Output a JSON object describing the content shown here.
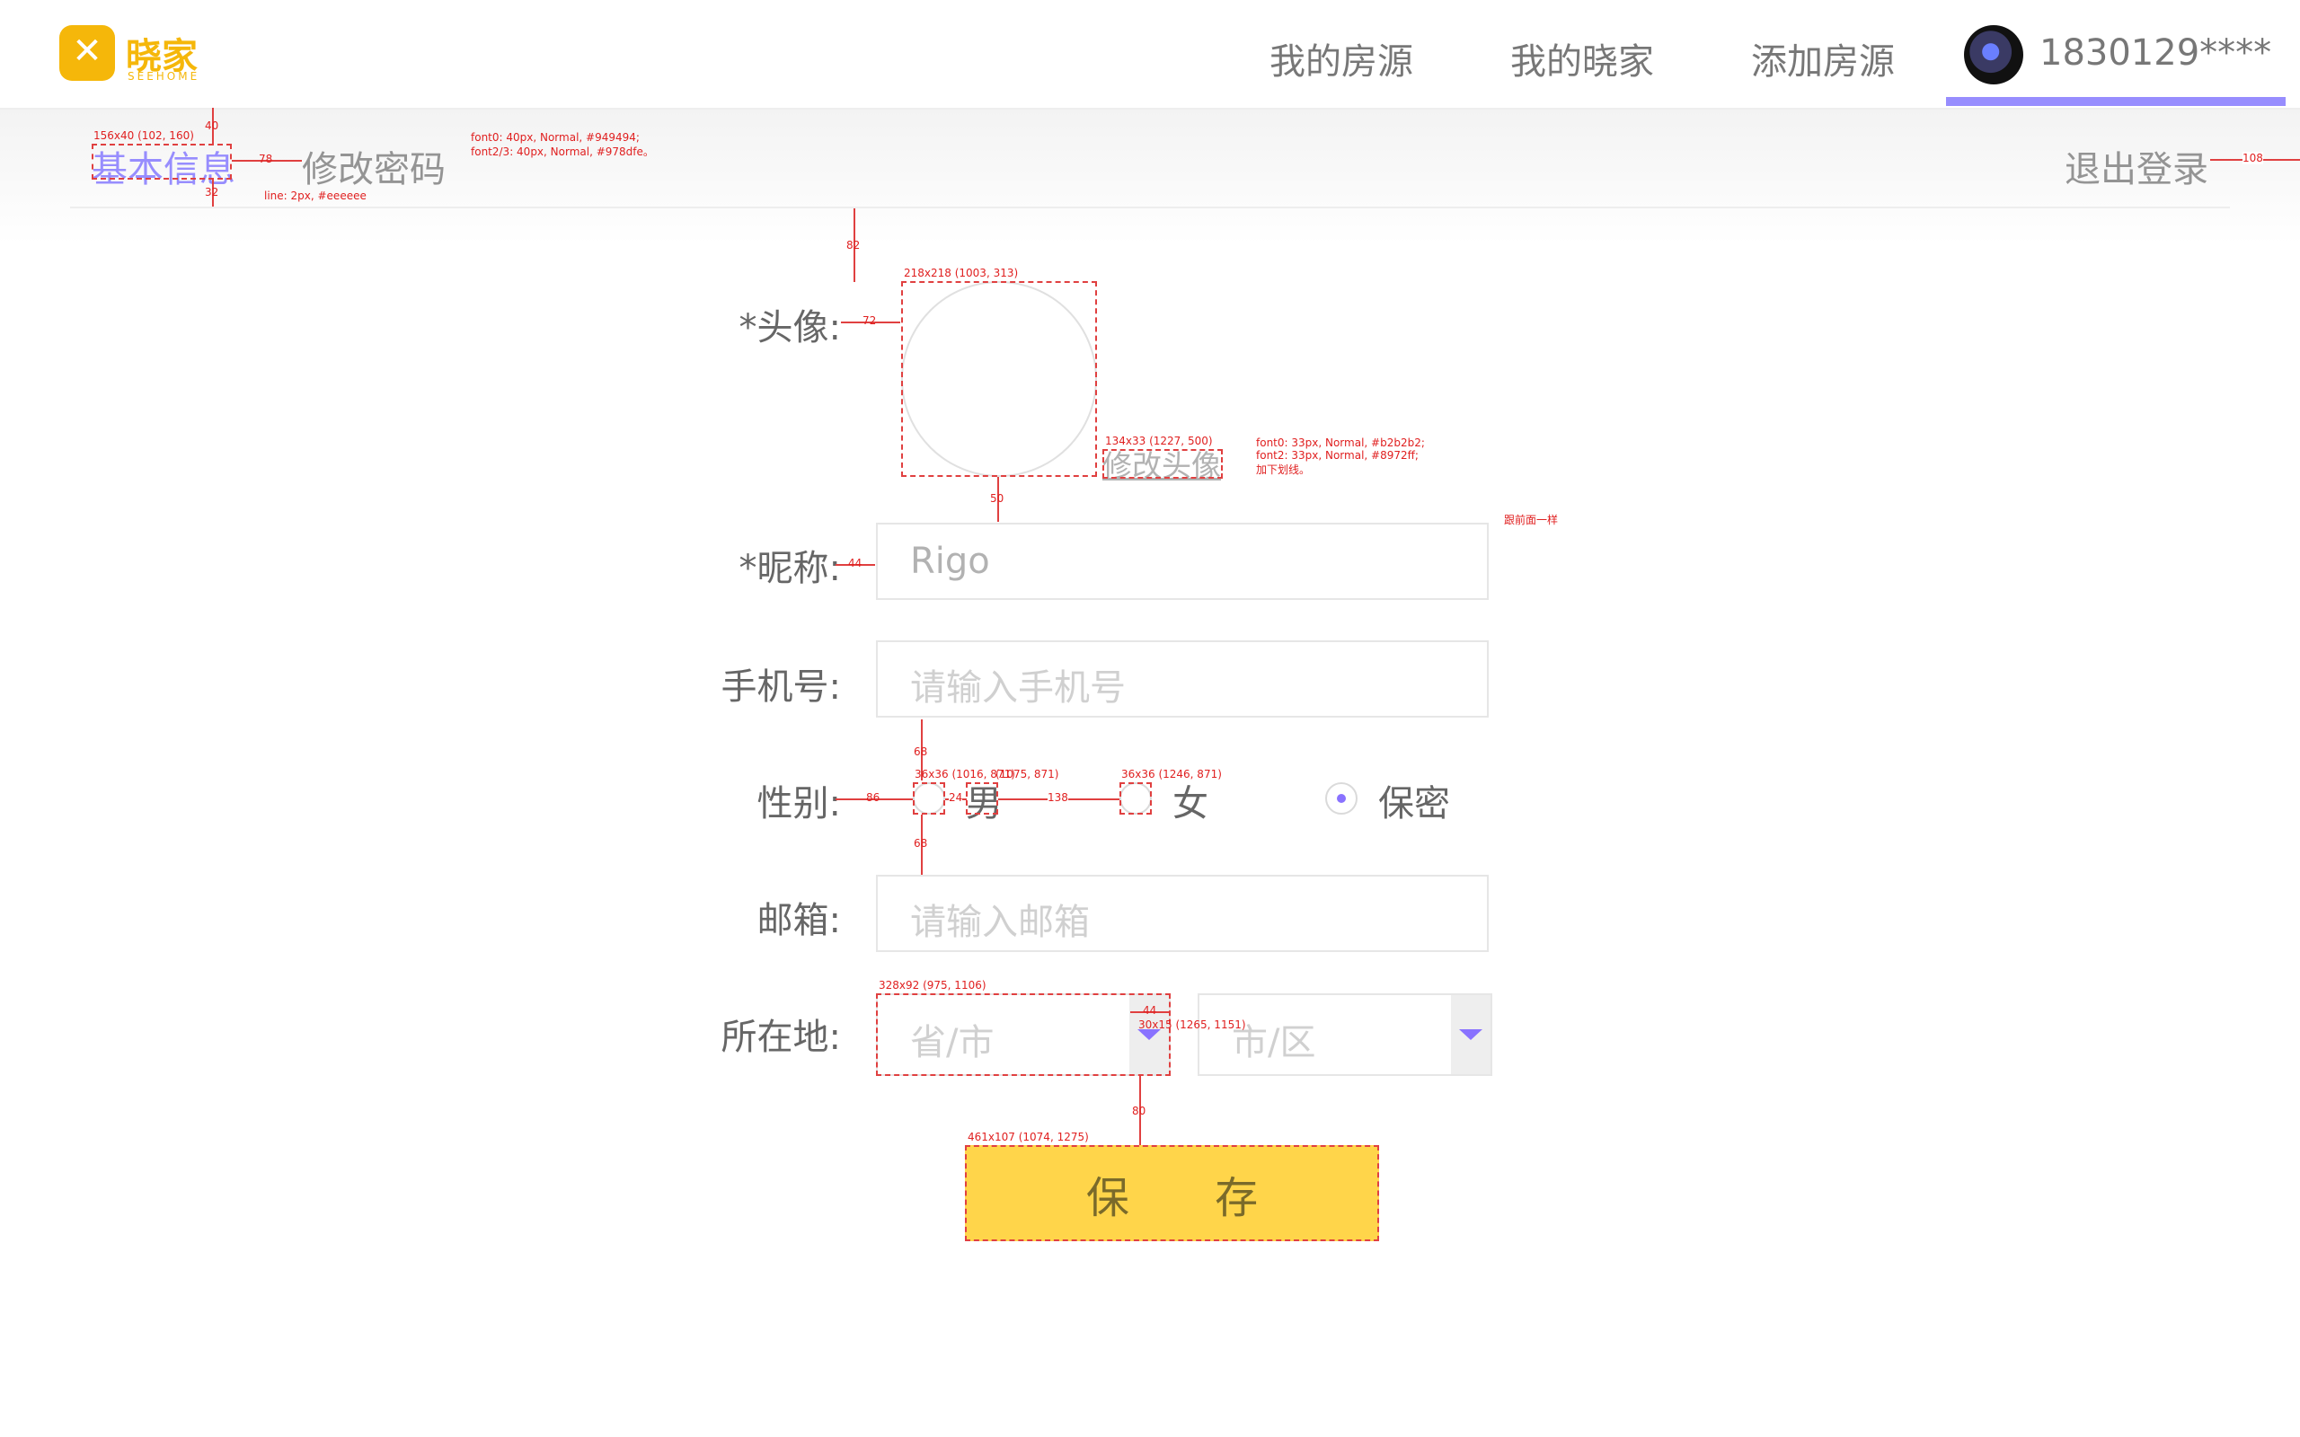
{
  "brand": {
    "name_cn": "晓家",
    "name_en": "SEEHOME"
  },
  "nav": {
    "links": [
      "我的房源",
      "我的晓家",
      "添加房源"
    ],
    "user": "1830129****"
  },
  "subnav": {
    "tab_basic": "基本信息",
    "tab_password": "修改密码",
    "logout": "退出登录"
  },
  "form": {
    "avatar_label": "*头像:",
    "change_avatar": "修改头像",
    "nickname_label": "*昵称:",
    "nickname_value": "Rigo",
    "phone_label": "手机号:",
    "phone_placeholder": "请输入手机号",
    "gender_label": "性别:",
    "gender_options": [
      "男",
      "女",
      "保密"
    ],
    "gender_selected": "保密",
    "email_label": "邮箱:",
    "email_placeholder": "请输入邮箱",
    "location_label": "所在地:",
    "province_placeholder": "省/市",
    "city_placeholder": "市/区",
    "save": "保 存"
  },
  "colors": {
    "accent": "#978dfe",
    "brand": "#f5b70a",
    "button": "#ffd54a",
    "text_gray": "#949494",
    "line": "#eeeeee"
  },
  "annotations": {
    "a1": "156x40 (102, 160)",
    "a2": "40",
    "a3": "78",
    "a4": "32",
    "a5": "font0: 40px, Normal, #949494;",
    "a6": "font2/3: 40px, Normal, #978dfe。",
    "a7": "line: 2px, #eeeeee",
    "a8": "108",
    "a9": "82",
    "a10": "218x218 (1003, 313)",
    "a11": "72",
    "a12": "134x33 (1227, 500)",
    "a13": "font0: 33px, Normal, #b2b2b2;",
    "a14": "font2: 33px, Normal, #8972ff;",
    "a15": "加下划线。",
    "a16": "50",
    "a17": "跟前面一样",
    "a18": "44",
    "a19": "68",
    "a20": "36x36 (1016, 871)",
    "a21": "(1075, 871)",
    "a22": "36x36 (1246, 871)",
    "a23": "86",
    "a24": "24",
    "a25": "138",
    "a26": "68",
    "a27": "328x92 (975, 1106)",
    "a28": "44",
    "a29": "30x15 (1265, 1151)",
    "a30": "80",
    "a31": "461x107 (1074, 1275)"
  }
}
